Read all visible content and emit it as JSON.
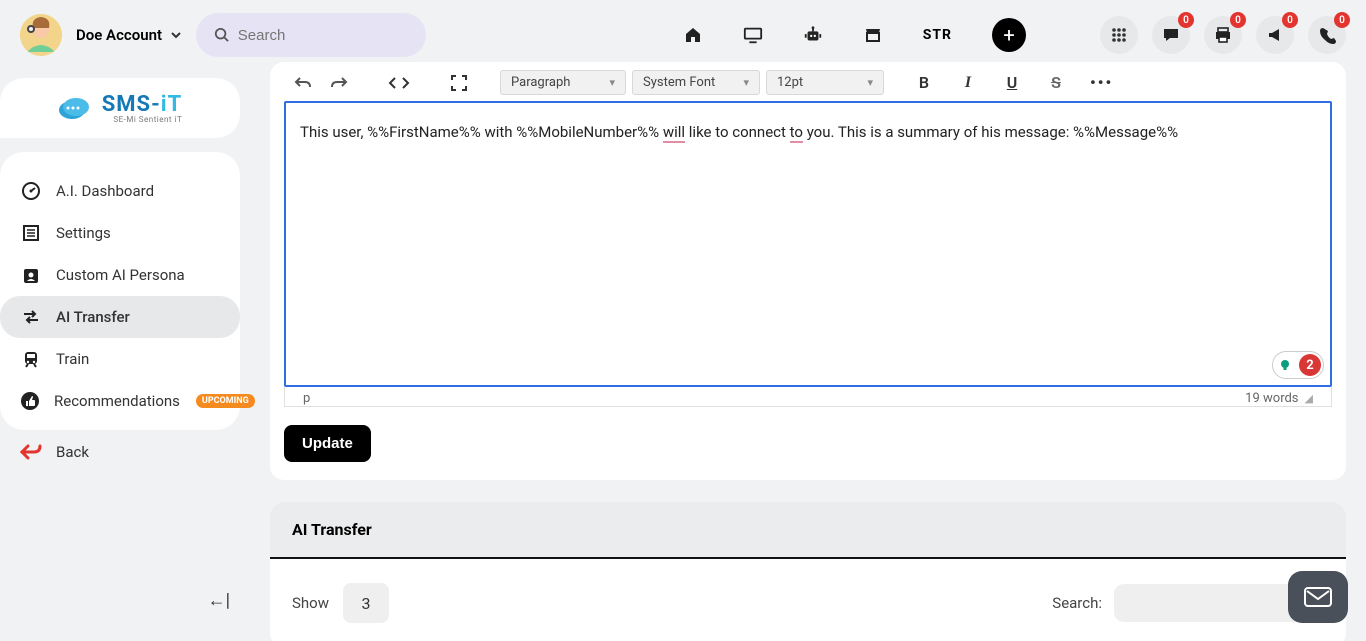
{
  "header": {
    "account_name": "Doe Account",
    "search_placeholder": "Search",
    "str_label": "STR",
    "badges": {
      "chat": "0",
      "print": "0",
      "announce": "0",
      "phone": "0"
    }
  },
  "logo": {
    "primary": "SMS-",
    "secondary": "iT",
    "sub": "SE-Mi Sentient iT"
  },
  "sidebar": {
    "items": [
      {
        "label": "A.I. Dashboard"
      },
      {
        "label": "Settings"
      },
      {
        "label": "Custom AI Persona"
      },
      {
        "label": "AI Transfer"
      },
      {
        "label": "Train"
      },
      {
        "label": "Recommendations",
        "badge": "UPCOMING"
      }
    ],
    "back_label": "Back"
  },
  "editor": {
    "block_style": "Paragraph",
    "font_family": "System Font",
    "font_size": "12pt",
    "content_pre": "This user, %%FirstName%% with %%MobileNumber%% ",
    "content_w1": "will",
    "content_mid": " like to connect ",
    "content_w2": "to",
    "content_post": " you. This is a summary of his message: %%Message%%",
    "path": "p",
    "word_count": "19 words",
    "issue_count": "2",
    "update_label": "Update"
  },
  "transfer_section": {
    "title": "AI Transfer",
    "show_label": "Show",
    "show_value": "3",
    "search_label": "Search:"
  }
}
